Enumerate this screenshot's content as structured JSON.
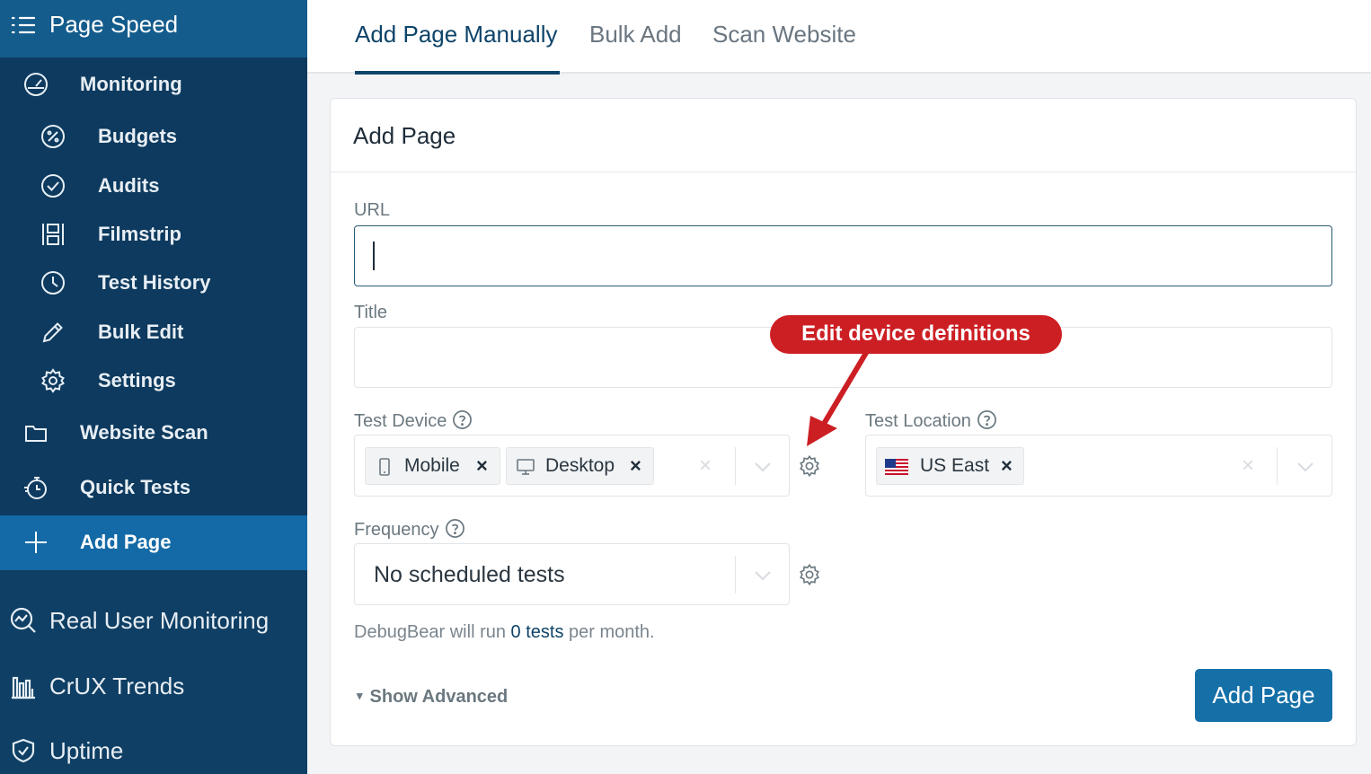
{
  "sidebar": {
    "header": {
      "title": "Page Speed",
      "icon": "list-icon"
    },
    "items": [
      {
        "label": "Monitoring",
        "icon": "gauge-icon",
        "level": 1
      },
      {
        "label": "Budgets",
        "icon": "percent-icon",
        "level": 2
      },
      {
        "label": "Audits",
        "icon": "check-circle-icon",
        "level": 2
      },
      {
        "label": "Filmstrip",
        "icon": "filmstrip-icon",
        "level": 2
      },
      {
        "label": "Test History",
        "icon": "clock-icon",
        "level": 2
      },
      {
        "label": "Bulk Edit",
        "icon": "pencil-icon",
        "level": 2
      },
      {
        "label": "Settings",
        "icon": "gear-icon",
        "level": 2
      },
      {
        "label": "Website Scan",
        "icon": "folder-icon",
        "level": 1
      },
      {
        "label": "Quick Tests",
        "icon": "stopwatch-icon",
        "level": 1
      },
      {
        "label": "Add Page",
        "icon": "plus-icon",
        "level": 1,
        "active": true
      }
    ],
    "bottom": [
      {
        "label": "Real User Monitoring",
        "icon": "rum-icon"
      },
      {
        "label": "CrUX Trends",
        "icon": "bar-chart-icon"
      },
      {
        "label": "Uptime",
        "icon": "shield-check-icon"
      }
    ]
  },
  "tabs": [
    {
      "label": "Add Page Manually",
      "active": true
    },
    {
      "label": "Bulk Add",
      "active": false
    },
    {
      "label": "Scan Website",
      "active": false
    }
  ],
  "form": {
    "title": "Add Page",
    "url": {
      "label": "URL",
      "value": ""
    },
    "title_field": {
      "label": "Title",
      "value": ""
    },
    "test_device": {
      "label": "Test Device",
      "selected": [
        {
          "label": "Mobile",
          "icon": "mobile-icon"
        },
        {
          "label": "Desktop",
          "icon": "desktop-icon"
        }
      ]
    },
    "test_location": {
      "label": "Test Location",
      "selected": [
        {
          "label": "US East",
          "icon": "us-flag-icon"
        }
      ]
    },
    "frequency": {
      "label": "Frequency",
      "value": "No scheduled tests"
    },
    "note": {
      "prefix": "DebugBear will run ",
      "count": "0",
      "middle": " tests",
      "suffix": " per month."
    },
    "show_advanced": "Show Advanced",
    "submit": "Add Page"
  },
  "callout": {
    "text": "Edit device definitions"
  },
  "colors": {
    "sidebar_bg": "#0d3a5e",
    "sidebar_header": "#145c8c",
    "active_item": "#146aa6",
    "primary": "#1670a8",
    "callout": "#cc1f24",
    "accent_text": "#0e4469"
  },
  "chips": {
    "remove": "×"
  },
  "controls": {
    "clear": "×"
  },
  "glyphs": {
    "triangle": "▾"
  }
}
